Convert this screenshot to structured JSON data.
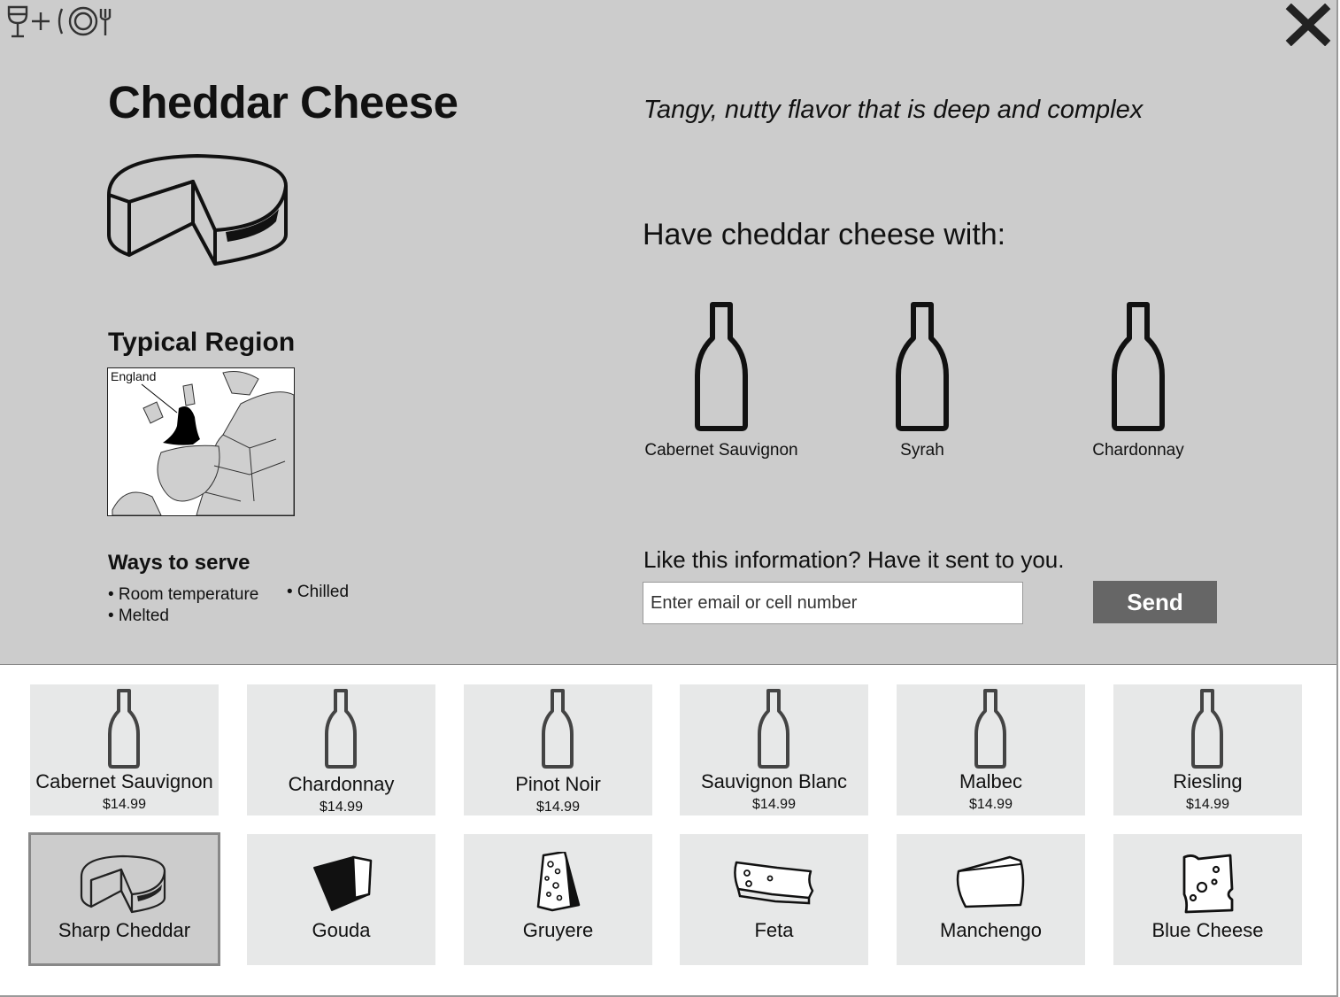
{
  "app": {
    "logo": "wine-plus-dinner-logo",
    "close_icon": "close-icon"
  },
  "detail": {
    "title": "Cheddar Cheese",
    "tagline": "Tangy, nutty flavor that is deep and complex",
    "pairing_heading": "Have cheddar cheese with:",
    "pairings": [
      {
        "label": "Cabernet Sauvignon",
        "icon": "wine-bottle-icon"
      },
      {
        "label": "Syrah",
        "icon": "wine-bottle-icon"
      },
      {
        "label": "Chardonnay",
        "icon": "wine-bottle-icon"
      }
    ],
    "region_heading": "Typical Region",
    "region_label": "England",
    "serve_heading": "Ways to serve",
    "serve_ways": [
      "• Room temperature",
      "• Chilled",
      "• Melted"
    ],
    "send_prompt": "Like this information? Have it sent to you.",
    "contact_placeholder": "Enter email or cell number",
    "send_label": "Send"
  },
  "wines": [
    {
      "name": "Cabernet Sauvignon",
      "price": "$14.99"
    },
    {
      "name": "Chardonnay",
      "price": "$14.99"
    },
    {
      "name": "Pinot Noir",
      "price": "$14.99"
    },
    {
      "name": "Sauvignon Blanc",
      "price": "$14.99"
    },
    {
      "name": "Malbec",
      "price": "$14.99"
    },
    {
      "name": "Riesling",
      "price": "$14.99"
    }
  ],
  "cheeses": [
    {
      "name": "Sharp Cheddar",
      "icon": "cheddar-wheel-icon",
      "selected": true
    },
    {
      "name": "Gouda",
      "icon": "gouda-wedge-icon",
      "selected": false
    },
    {
      "name": "Gruyere",
      "icon": "gruyere-wedge-icon",
      "selected": false
    },
    {
      "name": "Feta",
      "icon": "feta-block-icon",
      "selected": false
    },
    {
      "name": "Manchengo",
      "icon": "manchego-wedge-icon",
      "selected": false
    },
    {
      "name": "Blue Cheese",
      "icon": "blue-cheese-icon",
      "selected": false
    }
  ],
  "colors": {
    "panel": "#cccccc",
    "tile": "#e7e8e8",
    "send_button": "#666666"
  }
}
